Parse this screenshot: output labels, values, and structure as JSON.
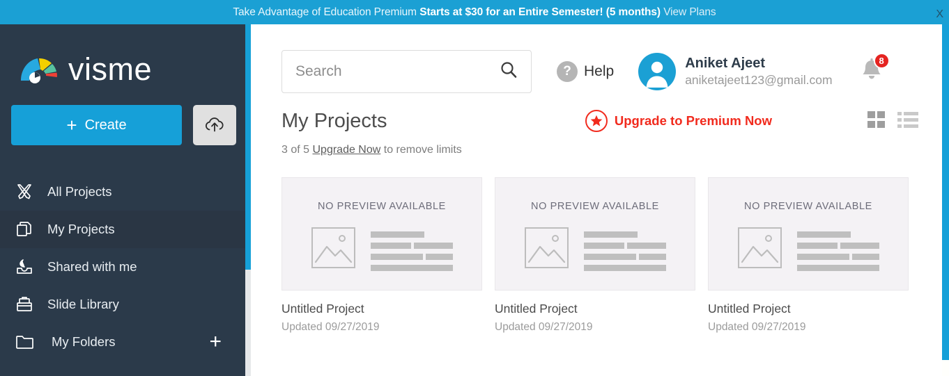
{
  "banner": {
    "lead": "Take Advantage of Education Premium ",
    "strong": "Starts at $30 for an Entire Semester! (5 months)",
    "link": " View Plans",
    "close_label": "X",
    "bg_color": "#1ba0d4"
  },
  "sidebar": {
    "brand": "visme",
    "create_label": "Create",
    "create_plus": "+",
    "upload_icon": "cloud-upload-icon",
    "accent_color": "#16a0d8",
    "bg_color": "#2b3a4a",
    "items": [
      {
        "label": "All Projects",
        "icon": "crossed-pencils-icon",
        "active": false
      },
      {
        "label": "My Projects",
        "icon": "copy-pages-icon",
        "active": true
      },
      {
        "label": "Shared with me",
        "icon": "inbox-share-icon",
        "active": false
      },
      {
        "label": "Slide Library",
        "icon": "slide-case-icon",
        "active": false
      },
      {
        "label": "My Folders",
        "icon": "folder-icon",
        "active": false,
        "add": "+"
      }
    ]
  },
  "header": {
    "search_placeholder": "Search",
    "search_value": "",
    "search_icon": "search-icon",
    "help_label": "Help",
    "help_icon": "question-mark-icon",
    "user_name": "Aniket Ajeet",
    "user_email": "aniketajeet123@gmail.com",
    "avatar_icon": "user-avatar-icon",
    "bell_icon": "notification-bell-icon",
    "bell_count": "8",
    "bell_badge_color": "#e52421"
  },
  "content": {
    "page_title": "My Projects",
    "upgrade_label": "Upgrade to Premium Now",
    "upgrade_color": "#f12b1e",
    "star_icon": "star-icon",
    "grid_view_icon": "grid-view-icon",
    "list_view_icon": "list-view-icon",
    "active_view": "grid",
    "limits_count": "3 of 5",
    "limits_link": "Upgrade Now",
    "limits_suffix": " to remove limits",
    "no_preview_label": "NO PREVIEW AVAILABLE",
    "projects": [
      {
        "name": "Untitled Project",
        "updated": "Updated 09/27/2019"
      },
      {
        "name": "Untitled Project",
        "updated": "Updated 09/27/2019"
      },
      {
        "name": "Untitled Project",
        "updated": "Updated 09/27/2019"
      }
    ]
  }
}
